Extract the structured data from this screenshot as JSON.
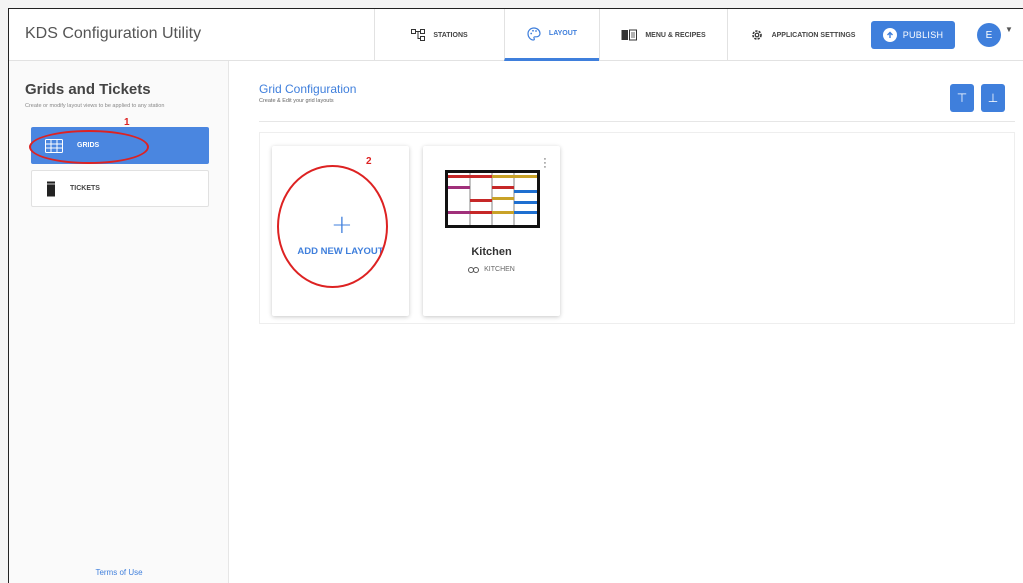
{
  "app": {
    "title": "KDS Configuration Utility"
  },
  "nav": {
    "items": [
      {
        "label": "STATIONS",
        "icon": "stations-icon",
        "active": false
      },
      {
        "label": "LAYOUT",
        "icon": "palette-icon",
        "active": true
      },
      {
        "label": "MENU & RECIPES",
        "icon": "book-icon",
        "active": false
      },
      {
        "label": "APPLICATION SETTINGS",
        "icon": "gear-icon",
        "active": false
      }
    ],
    "publish_label": "PUBLISH",
    "avatar_initial": "E"
  },
  "sidebar": {
    "title": "Grids and Tickets",
    "subtitle": "Create or modify layout views to be applied to any station",
    "items": [
      {
        "label": "GRIDS",
        "icon": "grid-icon",
        "active": true
      },
      {
        "label": "TICKETS",
        "icon": "ticket-icon",
        "active": false
      }
    ],
    "terms_label": "Terms of Use"
  },
  "main": {
    "title": "Grid Configuration",
    "subtitle": "Create & Edit your grid layouts",
    "upload_label": "⊤",
    "download_label": "⊥",
    "add_card": {
      "plus": "+",
      "label": "ADD NEW LAYOUT"
    },
    "layouts": [
      {
        "name": "Kitchen",
        "station": "KITCHEN",
        "link_icon": "link-icon"
      }
    ]
  },
  "annotations": {
    "one": "1",
    "two": "2"
  },
  "colors": {
    "accent": "#3f7fdc",
    "annotation": "#dd2222",
    "thumb_red": "#c62828",
    "thumb_gold": "#c9a227",
    "thumb_purple": "#a0307a",
    "thumb_blue": "#1e6fd0"
  }
}
